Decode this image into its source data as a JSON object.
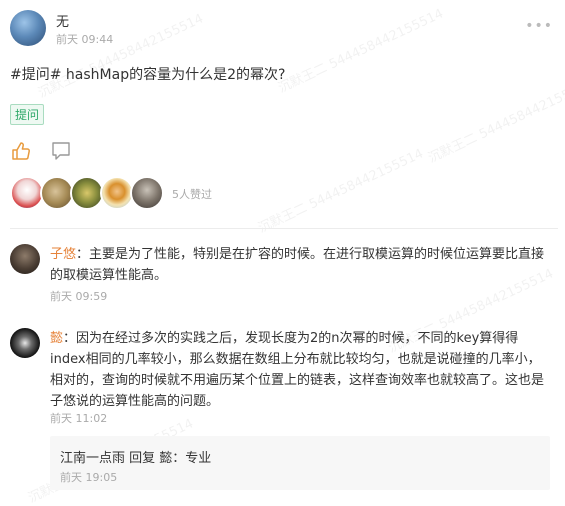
{
  "post": {
    "author": "无",
    "time": "前天 09:44",
    "title": "#提问# hashMap的容量为什么是2的幂次?",
    "tag": "提问",
    "likes_count": "5人赞过"
  },
  "comments": [
    {
      "user": "子悠",
      "separator": "：",
      "text": "主要是为了性能，特别是在扩容的时候。在进行取模运算的时候位运算要比直接的取模运算性能高。",
      "time": "前天 09:59"
    },
    {
      "user": "懿",
      "separator": "：",
      "text": "因为在经过多次的实践之后，发现长度为2的n次幂的时候，不同的key算得得index相同的几率较小，那么数据在数组上分布就比较均匀，也就是说碰撞的几率小，相对的，查询的时候就不用遍历某个位置上的链表，这样查询效率也就较高了。这也是子悠说的运算性能高的问题。",
      "time": "前天 11:02"
    }
  ],
  "reply": {
    "text": "江南一点雨 回复 懿：专业",
    "time": "前天 19:05"
  },
  "watermark": "沉默王二 544458442155514",
  "icons": {
    "more": "more-dots-icon",
    "like": "thumbs-up-icon",
    "comment": "comment-icon"
  },
  "colors": {
    "accent_green": "#2fa869",
    "username_orange": "#e6833a",
    "muted": "#aaaaaa"
  }
}
